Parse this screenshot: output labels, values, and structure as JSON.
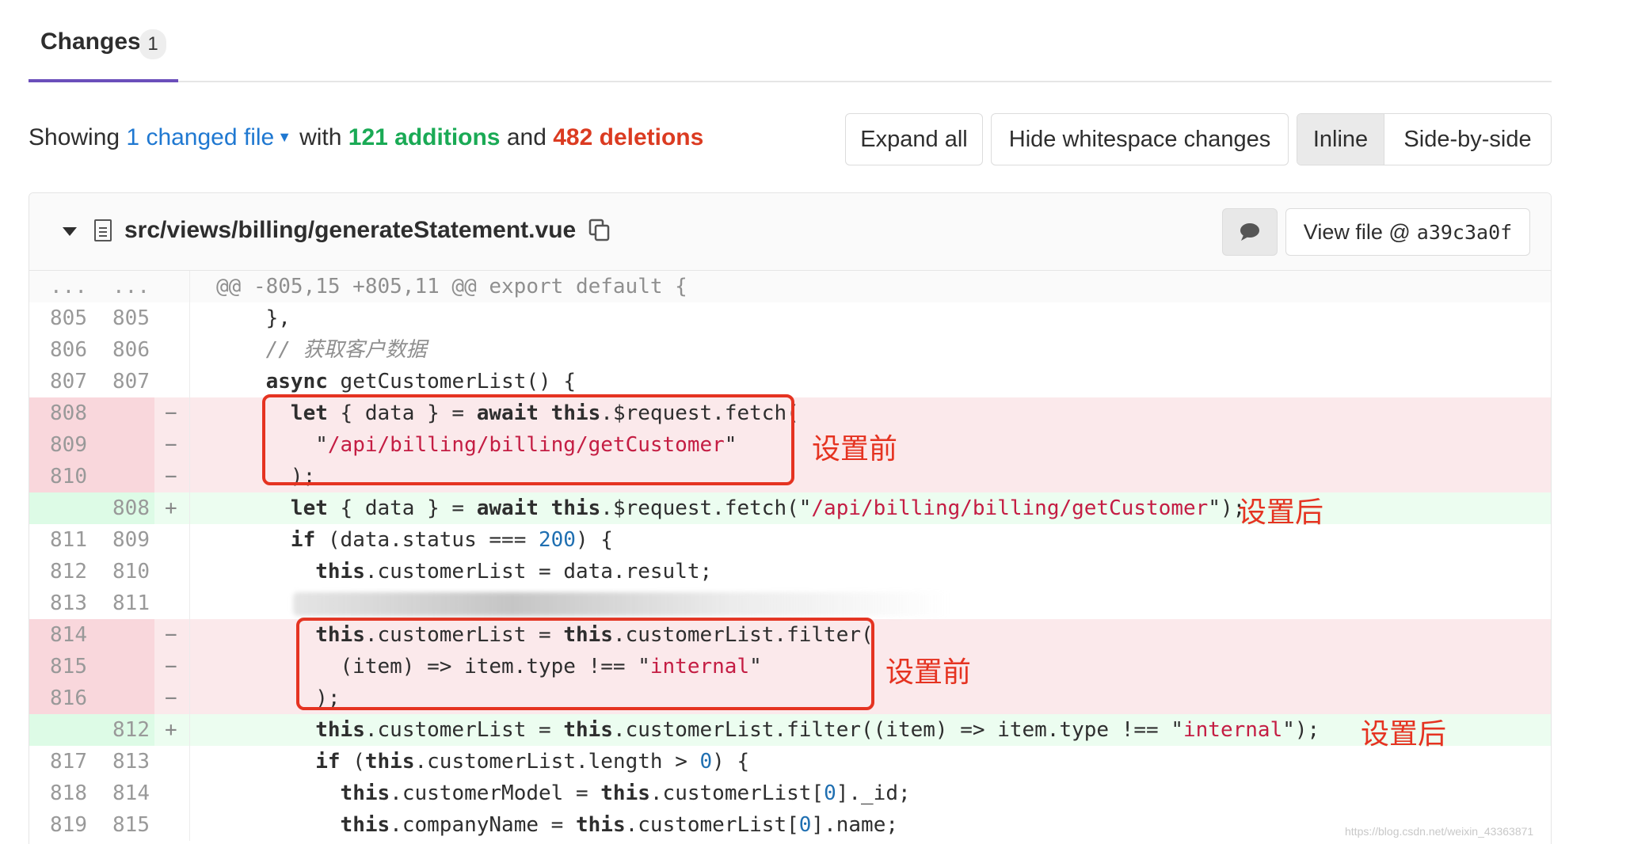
{
  "tabs": {
    "changes_label": "Changes",
    "changes_count": "1"
  },
  "summary": {
    "showing": "Showing",
    "changed_files": "1 changed file",
    "with": "with",
    "additions": "121 additions",
    "and": "and",
    "deletions": "482 deletions"
  },
  "toolbar": {
    "expand_all": "Expand all",
    "hide_whitespace": "Hide whitespace changes",
    "inline": "Inline",
    "side_by_side": "Side-by-side"
  },
  "file": {
    "path": "src/views/billing/generateStatement.vue",
    "view_file_label": "View file @",
    "view_file_sha": "a39c3a0f"
  },
  "diff_lines": [
    {
      "type": "match",
      "old": "...",
      "new": "...",
      "marker": "",
      "code": "@@ -805,15 +805,11 @@ export default {"
    },
    {
      "type": "context",
      "old": "805",
      "new": "805",
      "marker": "",
      "code": "    },"
    },
    {
      "type": "context",
      "old": "806",
      "new": "806",
      "marker": "",
      "code": "    // 获取客户数据"
    },
    {
      "type": "context",
      "old": "807",
      "new": "807",
      "marker": "",
      "code": "    async getCustomerList() {"
    },
    {
      "type": "old",
      "old": "808",
      "new": "",
      "marker": "−",
      "code": "      let { data } = await this.$request.fetch("
    },
    {
      "type": "old",
      "old": "809",
      "new": "",
      "marker": "−",
      "code": "        \"/api/billing/billing/getCustomer\""
    },
    {
      "type": "old",
      "old": "810",
      "new": "",
      "marker": "−",
      "code": "      );"
    },
    {
      "type": "new",
      "old": "",
      "new": "808",
      "marker": "+",
      "code": "      let { data } = await this.$request.fetch(\"/api/billing/billing/getCustomer\");"
    },
    {
      "type": "context",
      "old": "811",
      "new": "809",
      "marker": "",
      "code": "      if (data.status === 200) {"
    },
    {
      "type": "context",
      "old": "812",
      "new": "810",
      "marker": "",
      "code": "        this.customerList = data.result;"
    },
    {
      "type": "context",
      "old": "813",
      "new": "811",
      "marker": "",
      "code": ""
    },
    {
      "type": "old",
      "old": "814",
      "new": "",
      "marker": "−",
      "code": "        this.customerList = this.customerList.filter("
    },
    {
      "type": "old",
      "old": "815",
      "new": "",
      "marker": "−",
      "code": "          (item) => item.type !== \"internal\""
    },
    {
      "type": "old",
      "old": "816",
      "new": "",
      "marker": "−",
      "code": "        );"
    },
    {
      "type": "new",
      "old": "",
      "new": "812",
      "marker": "+",
      "code": "        this.customerList = this.customerList.filter((item) => item.type !== \"internal\");"
    },
    {
      "type": "context",
      "old": "817",
      "new": "813",
      "marker": "",
      "code": "        if (this.customerList.length > 0) {"
    },
    {
      "type": "context",
      "old": "818",
      "new": "814",
      "marker": "",
      "code": "          this.customerModel = this.customerList[0]._id;"
    },
    {
      "type": "context",
      "old": "819",
      "new": "815",
      "marker": "",
      "code": "          this.companyName = this.customerList[0].name;"
    }
  ],
  "annotations": {
    "before_1": "设置前",
    "after_1": "设置后",
    "before_2": "设置前",
    "after_2": "设置后"
  },
  "watermark": "https://blog.csdn.net/weixin_43363871",
  "colors": {
    "accent": "#6b4fbb",
    "link": "#1f78d1",
    "additions": "#1aaa55",
    "deletions": "#db3b21",
    "annotation": "#e53321",
    "old_line_bg": "#fbe9eb",
    "new_line_bg": "#ecfdf0"
  },
  "icons": {
    "collapse": "chevron-down-icon",
    "file": "file-icon",
    "copy": "copy-icon",
    "comment": "comment-icon"
  }
}
